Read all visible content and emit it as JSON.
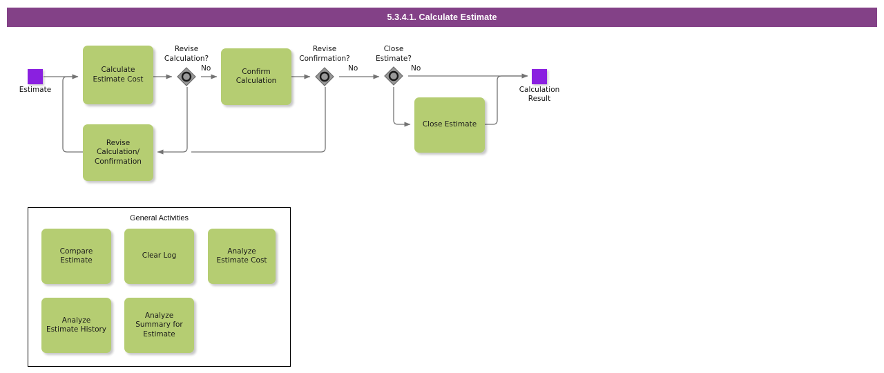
{
  "header": {
    "title": "5.3.4.1. Calculate Estimate",
    "background_color": "#834187",
    "text_color": "#ffffff"
  },
  "colors": {
    "task_fill": "#b5cd72",
    "event_fill": "#8a20e0",
    "gateway_fill": "#999999",
    "connector": "#737373",
    "group_border": "#000000"
  },
  "diagram": {
    "type": "bpmn-process-flow",
    "events": [
      {
        "id": "start",
        "name": "start-event",
        "label": "Estimate",
        "kind": "start"
      },
      {
        "id": "end",
        "name": "end-event",
        "label": "Calculation\nResult",
        "kind": "end"
      }
    ],
    "tasks": [
      {
        "id": "calculate_estimate_cost",
        "label": "Calculate\nEstimate Cost"
      },
      {
        "id": "confirm_calculation",
        "label": "Confirm\nCalculation"
      },
      {
        "id": "revise_calculation_confirmation",
        "label": "Revise\nCalculation/\nConfirmation"
      },
      {
        "id": "close_estimate",
        "label": "Close Estimate"
      }
    ],
    "gateways": [
      {
        "id": "revise_calculation",
        "label": "Revise\nCalculation?",
        "no_label": "No"
      },
      {
        "id": "revise_confirmation",
        "label": "Revise\nConfirmation?",
        "no_label": "No"
      },
      {
        "id": "close_estimate_gw",
        "label": "Close\nEstimate?",
        "no_label": "No"
      }
    ]
  },
  "group": {
    "title": "General Activities",
    "activities": [
      {
        "id": "compare_estimate",
        "label": "Compare\nEstimate"
      },
      {
        "id": "clear_log",
        "label": "Clear Log"
      },
      {
        "id": "analyze_estimate_cost",
        "label": "Analyze\nEstimate Cost"
      },
      {
        "id": "analyze_estimate_history",
        "label": "Analyze\nEstimate History"
      },
      {
        "id": "analyze_summary_for_estimate",
        "label": "Analyze\nSummary for\nEstimate"
      }
    ]
  }
}
